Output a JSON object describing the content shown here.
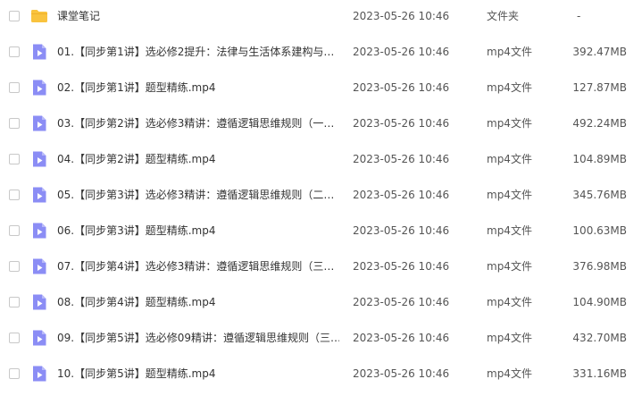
{
  "rows": [
    {
      "kind": "folder",
      "name": "课堂笔记",
      "date": "2023-05-26 10:46",
      "type": "文件夹",
      "size": "-"
    },
    {
      "kind": "video",
      "name": "01.【同步第1讲】选必修2提升：法律与生活体系建构与…",
      "date": "2023-05-26 10:46",
      "type": "mp4文件",
      "size": "392.47MB"
    },
    {
      "kind": "video",
      "name": "02.【同步第1讲】题型精练.mp4",
      "date": "2023-05-26 10:46",
      "type": "mp4文件",
      "size": "127.87MB"
    },
    {
      "kind": "video",
      "name": "03.【同步第2讲】选必修3精讲：遵循逻辑思维规则（一…",
      "date": "2023-05-26 10:46",
      "type": "mp4文件",
      "size": "492.24MB"
    },
    {
      "kind": "video",
      "name": "04.【同步第2讲】题型精练.mp4",
      "date": "2023-05-26 10:46",
      "type": "mp4文件",
      "size": "104.89MB"
    },
    {
      "kind": "video",
      "name": "05.【同步第3讲】选必修3精讲：遵循逻辑思维规则（二…",
      "date": "2023-05-26 10:46",
      "type": "mp4文件",
      "size": "345.76MB"
    },
    {
      "kind": "video",
      "name": "06.【同步第3讲】题型精练.mp4",
      "date": "2023-05-26 10:46",
      "type": "mp4文件",
      "size": "100.63MB"
    },
    {
      "kind": "video",
      "name": "07.【同步第4讲】选必修3精讲：遵循逻辑思维规则（三…",
      "date": "2023-05-26 10:46",
      "type": "mp4文件",
      "size": "376.98MB"
    },
    {
      "kind": "video",
      "name": "08.【同步第4讲】题型精练.mp4",
      "date": "2023-05-26 10:46",
      "type": "mp4文件",
      "size": "104.90MB"
    },
    {
      "kind": "video",
      "name": "09.【同步第5讲】选必修09精讲：遵循逻辑思维规则（三…",
      "date": "2023-05-26 10:46",
      "type": "mp4文件",
      "size": "432.70MB"
    },
    {
      "kind": "video",
      "name": "10.【同步第5讲】题型精练.mp4",
      "date": "2023-05-26 10:46",
      "type": "mp4文件",
      "size": "331.16MB"
    }
  ],
  "colors": {
    "folder": "#f9c33e",
    "video": "#8b8df5",
    "text": "#333333",
    "muted": "#555555",
    "checkbox_border": "#c8c8c8"
  },
  "icons": {
    "folder": "folder-icon",
    "video": "video-file-icon"
  }
}
